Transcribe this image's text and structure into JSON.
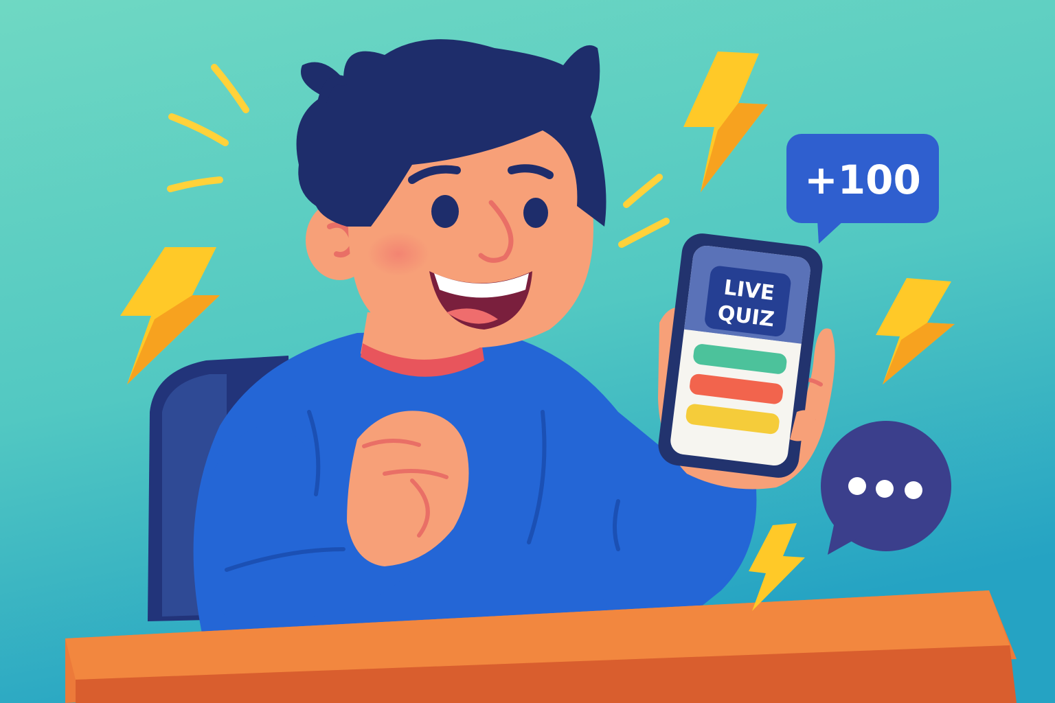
{
  "colors": {
    "background_top": "#6ad6c2",
    "background_bottom": "#2aa9c4",
    "shirt": "#2466d6",
    "skin": "#f7a078",
    "hair": "#1e2d6b",
    "desk": "#ec7a3a",
    "bolt": "#ffc928",
    "score_bubble": "#2f5fcf",
    "chat_bubble": "#3b3f8c"
  },
  "phone": {
    "title_line1": "LIVE",
    "title_line2": "QUIZ",
    "answers": [
      {
        "icon": "answer-bar-green",
        "color": "#4cc29b"
      },
      {
        "icon": "answer-bar-red",
        "color": "#f2644d"
      },
      {
        "icon": "answer-bar-yellow",
        "color": "#f5cc3a"
      }
    ]
  },
  "score_bubble": {
    "text": "+100"
  },
  "chat_bubble": {
    "icon": "ellipsis-icon"
  },
  "decorations": {
    "icon": "lightning-bolt-icon"
  }
}
